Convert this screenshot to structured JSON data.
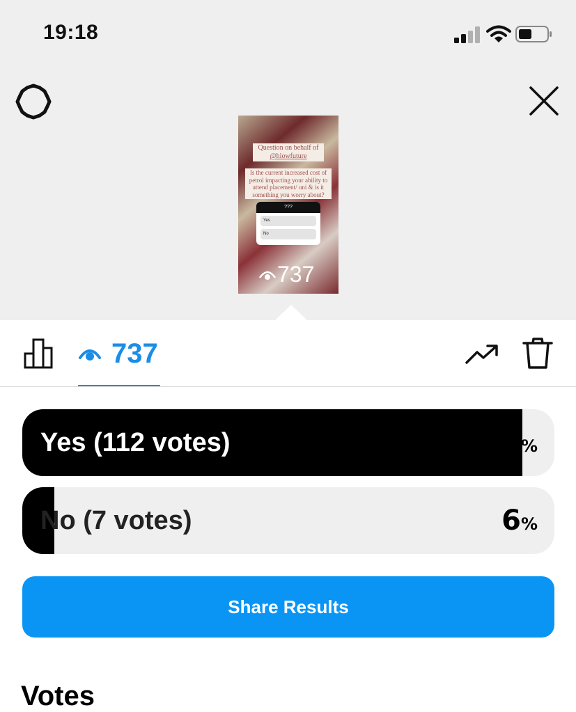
{
  "status_bar": {
    "time": "19:18"
  },
  "story_preview": {
    "question_line1": "Question on behalf of",
    "question_handle": "@hiowfuture",
    "question_body": "Is the current increased cost of petrol impacting your ability to attend placement/ uni & is it something you worry about?",
    "poll_title": "???",
    "poll_options": [
      "Yes",
      "No"
    ],
    "views": "737"
  },
  "tabs": {
    "viewers_count": "737"
  },
  "poll_results": [
    {
      "label": "Yes (112 votes)",
      "percent_value": "94",
      "percent_sign": "%",
      "fill": 0.94
    },
    {
      "label": "No (7 votes)",
      "percent_value": "6",
      "percent_sign": "%",
      "fill": 0.06
    }
  ],
  "share_button": {
    "label": "Share Results"
  },
  "section_heading": "Votes",
  "colors": {
    "accent": "#0a95f5",
    "tab_blue": "#1a8ee6",
    "bar_fill": "#000000",
    "bar_track": "#efeff0"
  },
  "icons": [
    "settings-gear-icon",
    "close-icon",
    "eye-icon",
    "bar-chart-icon",
    "trending-icon",
    "trash-icon",
    "signal-icon",
    "wifi-icon",
    "battery-icon"
  ]
}
